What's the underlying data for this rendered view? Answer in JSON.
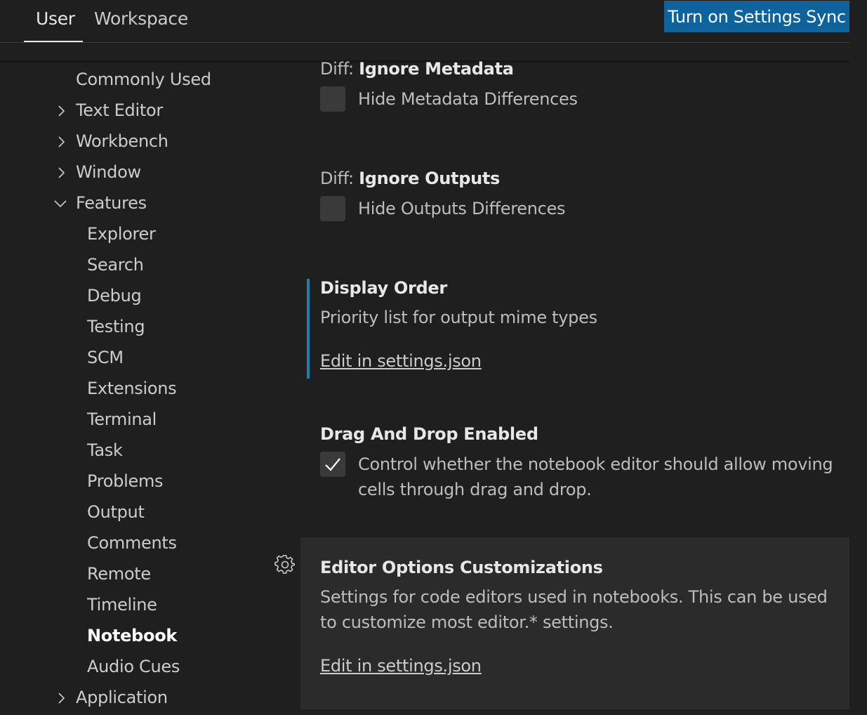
{
  "tabs": {
    "user": "User",
    "workspace": "Workspace"
  },
  "sync_button": "Turn on Settings Sync",
  "toc": {
    "commonly_used": "Commonly Used",
    "text_editor": "Text Editor",
    "workbench": "Workbench",
    "window": "Window",
    "features": "Features",
    "features_children": [
      "Explorer",
      "Search",
      "Debug",
      "Testing",
      "SCM",
      "Extensions",
      "Terminal",
      "Task",
      "Problems",
      "Output",
      "Comments",
      "Remote",
      "Timeline",
      "Notebook",
      "Audio Cues"
    ],
    "application": "Application",
    "selected": "Notebook"
  },
  "settings": {
    "ignore_metadata": {
      "category": "Diff: ",
      "title": "Ignore Metadata",
      "label": "Hide Metadata Differences",
      "checked": false
    },
    "ignore_outputs": {
      "category": "Diff: ",
      "title": "Ignore Outputs",
      "label": "Hide Outputs Differences",
      "checked": false
    },
    "display_order": {
      "title": "Display Order",
      "description": "Priority list for output mime types",
      "link": "Edit in settings.json"
    },
    "drag_drop": {
      "title": "Drag And Drop Enabled",
      "label_line1": "Control whether the notebook editor should allow moving",
      "label_line2": "cells through drag and drop.",
      "checked": true
    },
    "editor_options": {
      "title": "Editor Options Customizations",
      "description_line1": "Settings for code editors used in notebooks. This can be used",
      "description_line2": "to customize most editor.* settings.",
      "link": "Edit in settings.json"
    }
  },
  "colors": {
    "accent_button": "#0e639c",
    "modified_indicator": "#1b81a8",
    "background": "#1f1f1f",
    "focused_row": "#2b2b2b"
  }
}
